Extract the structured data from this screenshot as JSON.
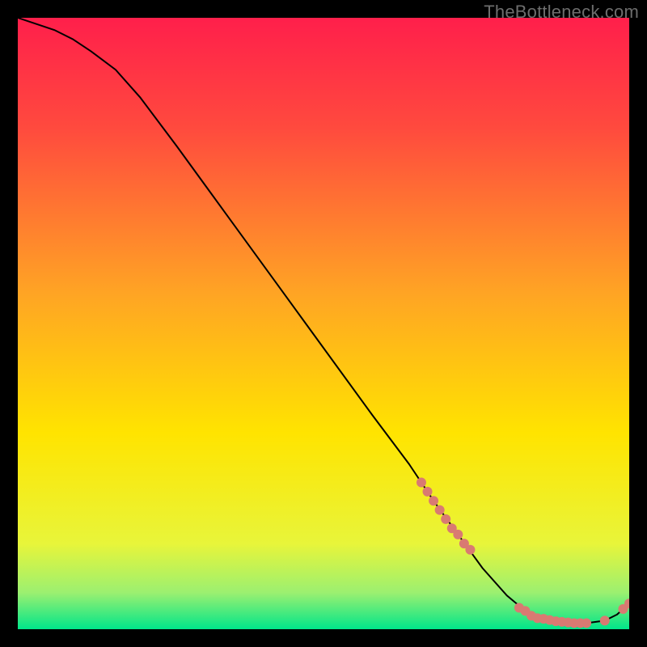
{
  "watermark": "TheBottleneck.com",
  "chart_data": {
    "type": "line",
    "title": "",
    "xlabel": "",
    "ylabel": "",
    "xlim": [
      0,
      100
    ],
    "ylim": [
      0,
      100
    ],
    "grid": false,
    "legend": false,
    "background_gradient": {
      "top_color": "#ff1f4b",
      "mid_color": "#ffe400",
      "bottom_color": "#00e58a",
      "direction": "vertical"
    },
    "series": [
      {
        "name": "curve",
        "type": "line",
        "color": "#000000",
        "x": [
          0,
          3,
          6,
          9,
          12,
          16,
          20,
          26,
          34,
          42,
          50,
          58,
          64,
          68,
          72,
          76,
          80,
          83,
          86,
          88,
          90,
          93,
          96,
          98,
          100
        ],
        "y": [
          100,
          99,
          98,
          96.5,
          94.5,
          91.5,
          87,
          79,
          68,
          57,
          46,
          35,
          27,
          21,
          15.5,
          10,
          5.5,
          3,
          1.7,
          1.2,
          1.0,
          1.0,
          1.4,
          2.4,
          4.2
        ]
      },
      {
        "name": "highlight-points",
        "type": "scatter",
        "color": "#d97a72",
        "marker_radius_px": 6,
        "x": [
          66,
          67,
          68,
          69,
          70,
          71,
          72,
          73,
          74,
          82,
          83,
          84,
          85,
          86,
          87,
          88,
          89,
          90,
          91,
          92,
          93,
          96,
          99,
          100
        ],
        "y": [
          24,
          22.5,
          21,
          19.5,
          18,
          16.5,
          15.5,
          14,
          13,
          3.5,
          3,
          2.2,
          1.8,
          1.7,
          1.5,
          1.3,
          1.2,
          1.1,
          1.0,
          1.0,
          1.0,
          1.4,
          3.3,
          4.2
        ]
      }
    ]
  }
}
